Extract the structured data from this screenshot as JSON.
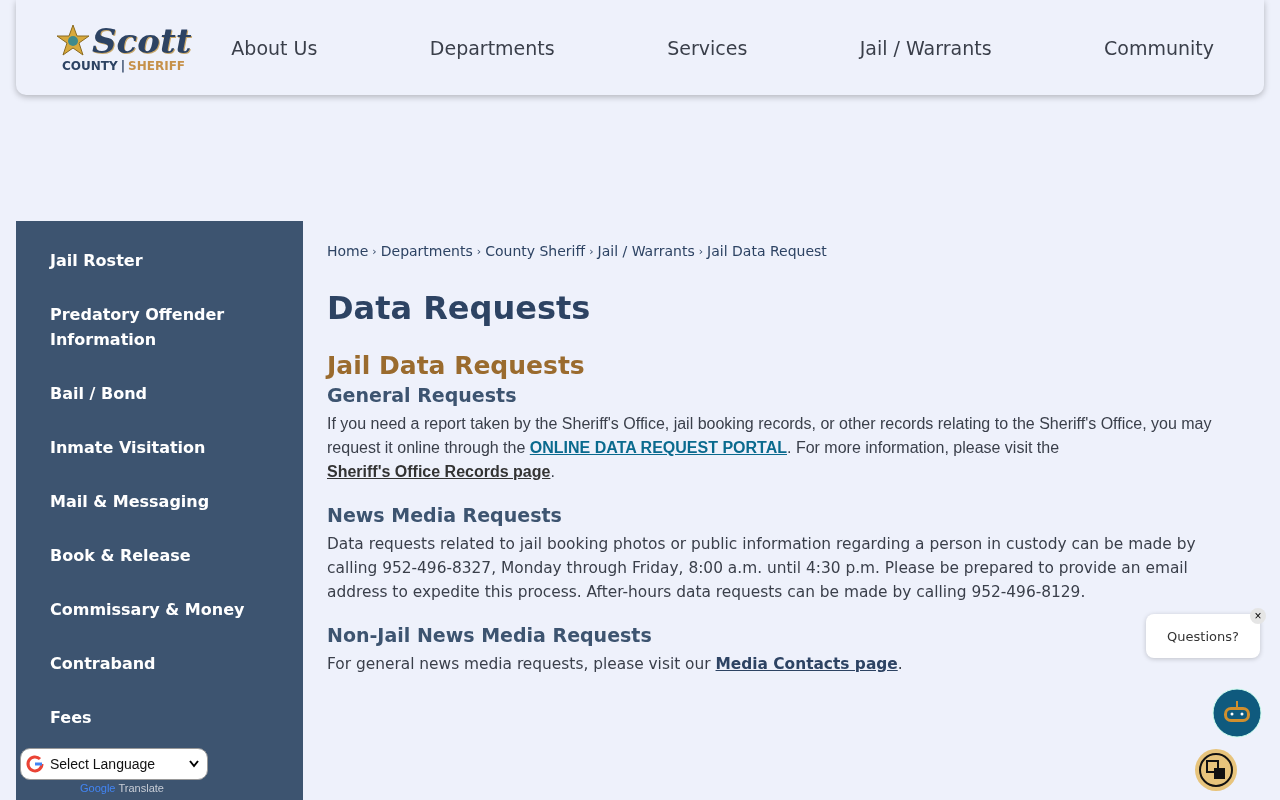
{
  "logo": {
    "name": "Scott",
    "sub_left": "COUNTY",
    "separator": "|",
    "sub_right": "SHERIFF"
  },
  "nav": [
    "About Us",
    "Departments",
    "Services",
    "Jail / Warrants",
    "Community"
  ],
  "sidebar": {
    "items": [
      {
        "label": "Jail Roster",
        "selected": false
      },
      {
        "label": "Predatory Offender Information",
        "selected": false
      },
      {
        "label": "Bail / Bond",
        "selected": false
      },
      {
        "label": "Inmate Visitation",
        "selected": false
      },
      {
        "label": "Mail & Messaging",
        "selected": false
      },
      {
        "label": "Book & Release",
        "selected": false
      },
      {
        "label": "Commissary & Money",
        "selected": false
      },
      {
        "label": "Contraband",
        "selected": false
      },
      {
        "label": "Fees",
        "selected": false
      }
    ]
  },
  "breadcrumb": {
    "separator": "›",
    "items": [
      "Home",
      "Departments",
      "County Sheriff",
      "Jail / Warrants",
      "Jail Data Request"
    ]
  },
  "page_title": "Data Requests",
  "section_title": "Jail Data Requests",
  "sections": [
    {
      "heading": "General Requests",
      "parts": [
        {
          "kind": "text",
          "text": "If you need a report taken by the Sheriff's Office, jail booking records, or other records relating to the Sheriff's Office, you may request it online through the "
        },
        {
          "kind": "link",
          "text": "ONLINE DATA REQUEST PORTAL"
        },
        {
          "kind": "text",
          "text": ". For more information, please visit the "
        },
        {
          "kind": "link",
          "text": "Sheriff's Office Records page"
        },
        {
          "kind": "text",
          "text": "."
        }
      ]
    },
    {
      "heading": "News Media Requests",
      "parts": [
        {
          "kind": "text",
          "text": "Data requests related to jail booking photos or public information regarding a person in custody can be made by calling 952-496-8327, Monday through Friday, 8:00 a.m. until 4:30 p.m. Please be prepared to provide an email address to expedite this process.  After-hours data requests can be made by calling 952-496-8129."
        }
      ]
    },
    {
      "heading": "Non-Jail News Media Requests",
      "parts": [
        {
          "kind": "text",
          "text": "For general news media requests, please visit our "
        },
        {
          "kind": "link",
          "text": "Media Contacts page"
        },
        {
          "kind": "text",
          "text": "."
        }
      ]
    }
  ],
  "language": {
    "value": "Select Language",
    "powered_by": "Google",
    "powered_word": "Translate"
  },
  "chat": {
    "prompt": "Questions?",
    "close": "×"
  }
}
